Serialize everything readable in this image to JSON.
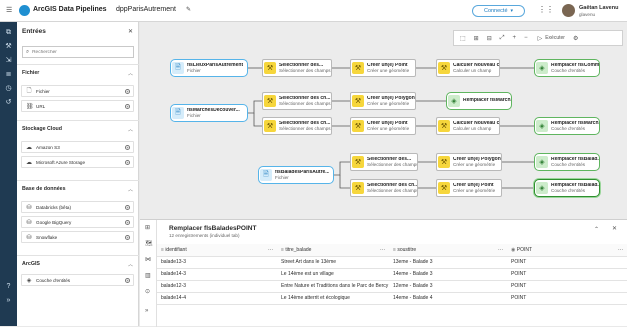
{
  "app": {
    "title": "ArcGIS Data Pipelines",
    "doc_name": "dppParisAutrement",
    "status": "Connecté",
    "user_name": "Gaëtan Lavenu",
    "user_handle": "glavenu"
  },
  "panel": {
    "title": "Entrées",
    "search_placeholder": "Rechercher",
    "sections": [
      {
        "label": "Fichier",
        "items": [
          {
            "label": "Fichier",
            "icon": "file-icon"
          },
          {
            "label": "URL",
            "icon": "link-icon"
          }
        ]
      },
      {
        "label": "Stockage Cloud",
        "items": [
          {
            "label": "Amazon S3",
            "icon": "cloud-icon"
          },
          {
            "label": "Microsoft Azure Storage",
            "icon": "cloud-icon"
          }
        ]
      },
      {
        "label": "Base de données",
        "items": [
          {
            "label": "Databricks (bêta)",
            "icon": "database-icon"
          },
          {
            "label": "Google BigQuery",
            "icon": "database-icon"
          },
          {
            "label": "Snowflake",
            "icon": "database-icon"
          }
        ]
      },
      {
        "label": "ArcGIS",
        "items": [
          {
            "label": "Couche d'entités",
            "icon": "layer-icon"
          }
        ]
      }
    ]
  },
  "toolbar": {
    "run_label": "Exécuter"
  },
  "nodes": {
    "in1": {
      "t1": "flsLieuxParisAutrement",
      "t2": "Fichier"
    },
    "in2": {
      "t1": "flsMarchesDecouver...",
      "t2": "Fichier"
    },
    "in3": {
      "t1": "flsBaladesParisAutre...",
      "t2": "Fichier"
    },
    "s1": {
      "t1": "Sélectionner des...",
      "t2": "Sélectionner des champs"
    },
    "g1": {
      "t1": "Créer un(e) Point",
      "t2": "Créer une géométrie"
    },
    "c1": {
      "t1": "Calculer Nouveau ch...",
      "t2": "Calculer un champ"
    },
    "o1": {
      "t1": "Remplacer flsComm...",
      "t2": "Couche d'entités"
    },
    "s2": {
      "t1": "Sélectionner des ch...",
      "t2": "Sélectionner des champs"
    },
    "g2": {
      "t1": "Créer un(e) Polygone",
      "t2": "Créer une géométrie"
    },
    "o2": {
      "t1": "Remplacer flsMarch...",
      "t2": ""
    },
    "s3": {
      "t1": "Sélectionner des ch...",
      "t2": "Sélectionner des champs"
    },
    "g3": {
      "t1": "Créer un(e) Point",
      "t2": "Créer une géométrie"
    },
    "c3": {
      "t1": "Calculer Nouveau ch...",
      "t2": "Calculer un champ"
    },
    "o3": {
      "t1": "Remplacer flsMarch...",
      "t2": "Couche d'entités"
    },
    "s4": {
      "t1": "Sélectionner des...",
      "t2": "Sélectionner des champs"
    },
    "g4": {
      "t1": "Créer un(e) Polygone",
      "t2": "Créer une géométrie"
    },
    "o4": {
      "t1": "Remplacer flsBalad...",
      "t2": "Couche d'entités"
    },
    "s5": {
      "t1": "Sélectionner des ch...",
      "t2": "Sélectionner des champs"
    },
    "g5": {
      "t1": "Créer un(e) Point",
      "t2": "Créer une géométrie"
    },
    "o5": {
      "t1": "Remplacer flsBalad...",
      "t2": "Couche d'entités"
    }
  },
  "preview": {
    "title": "Remplacer flsBaladesPOINT",
    "subtitle": "12 enregistrements (individuel tab)",
    "columns": [
      "identifiant",
      "titre_balade",
      "soustitre",
      "POINT"
    ],
    "rows": [
      [
        "balade13-3",
        "Street Art dans le 13ème",
        "13eme - Balade 3",
        "POINT"
      ],
      [
        "balade14-3",
        "Le 14ème est un village",
        "14eme - Balade 3",
        "POINT"
      ],
      [
        "balade12-3",
        "Entre Nature et Traditions dans le Parc de Bercy",
        "12eme - Balade 3",
        "POINT"
      ],
      [
        "balade14-4",
        "Le 14ème atterrit et écologique",
        "14eme - Balade 4",
        "POINT"
      ]
    ]
  }
}
